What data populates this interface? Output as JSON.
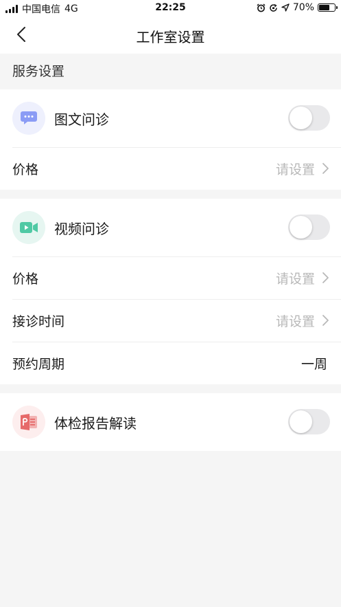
{
  "status_bar": {
    "carrier": "中国电信",
    "network": "4G",
    "time": "22:25",
    "battery": "70%",
    "battery_level": 0.7
  },
  "nav": {
    "title": "工作室设置"
  },
  "section": {
    "title": "服务设置"
  },
  "services": [
    {
      "name": "图文问诊",
      "icon": "chat-bubble-icon",
      "icon_bg": "#eef0fd",
      "icon_color": "#8b9cf5",
      "enabled": false,
      "rows": [
        {
          "label": "价格",
          "value": "请设置"
        }
      ]
    },
    {
      "name": "视频问诊",
      "icon": "video-camera-icon",
      "icon_bg": "#e6f6f1",
      "icon_color": "#4fc9a4",
      "enabled": false,
      "rows": [
        {
          "label": "价格",
          "value": "请设置"
        },
        {
          "label": "接诊时间",
          "value": "请设置"
        },
        {
          "label": "预约周期",
          "value": "一周"
        }
      ]
    },
    {
      "name": "体检报告解读",
      "icon": "report-document-icon",
      "icon_bg": "#fdeeee",
      "icon_color": "#e66a6a",
      "enabled": false,
      "rows": []
    }
  ],
  "colors": {
    "background": "#f5f5f5",
    "placeholder_text": "#b8b8b8",
    "toggle_off": "#e9e9eb"
  }
}
